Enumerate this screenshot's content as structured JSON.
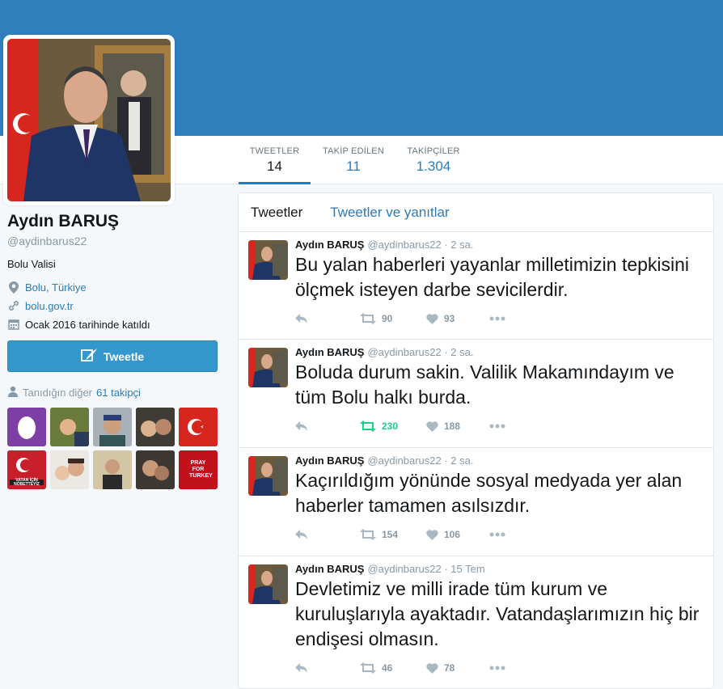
{
  "profile": {
    "name": "Aydın BARUŞ",
    "handle": "@aydinbarus22",
    "bio": "Bolu Valisi",
    "location": "Bolu, Türkiye",
    "website": "bolu.gov.tr",
    "joined": "Ocak 2016 tarihinde katıldı",
    "tweet_button": "Tweetle",
    "known_prefix": "Tanıdığın diğer",
    "known_link": "61 takipçi"
  },
  "stats": [
    {
      "label": "TWEETLER",
      "value": "14"
    },
    {
      "label": "TAKİP EDİLEN",
      "value": "11"
    },
    {
      "label": "TAKİPÇİLER",
      "value": "1.304"
    }
  ],
  "tabs": {
    "active": "Tweetler",
    "other": "Tweetler ve yanıtlar"
  },
  "tweets": [
    {
      "name": "Aydın BARUŞ",
      "meta": "@aydinbarus22 · 2 sa.",
      "text": "Bu yalan haberleri yayanlar milletimizin tepkisini ölçmek isteyen darbe sevicilerdir.",
      "retweets": "90",
      "likes": "93"
    },
    {
      "name": "Aydın BARUŞ",
      "meta": "@aydinbarus22 · 2 sa.",
      "text": "Boluda durum sakin. Valilik Makamındayım ve tüm Bolu halkı burda.",
      "retweets": "230",
      "likes": "188"
    },
    {
      "name": "Aydın BARUŞ",
      "meta": "@aydinbarus22 · 2 sa.",
      "text": "Kaçırıldığım yönünde sosyal medyada yer alan haberler tamamen asılsızdır.",
      "retweets": "154",
      "likes": "106"
    },
    {
      "name": "Aydın BARUŞ",
      "meta": "@aydinbarus22 · 15 Tem",
      "text": "Devletimiz ve milli irade tüm kurum ve kuruluşlarıyla ayaktadır. Vatandaşlarımızın hiç bir endişesi olmasın.",
      "retweets": "46",
      "likes": "78"
    }
  ],
  "follower_thumbs": {
    "pray_text": "PRAY FOR TURKEY",
    "vatan_text": "VATAN İÇİN NÖBETTEYİZ"
  },
  "colors": {
    "banner": "#2f7fbd",
    "link": "#2b7bb9",
    "button": "#3498cf",
    "retweet_active": "#19cf86"
  }
}
